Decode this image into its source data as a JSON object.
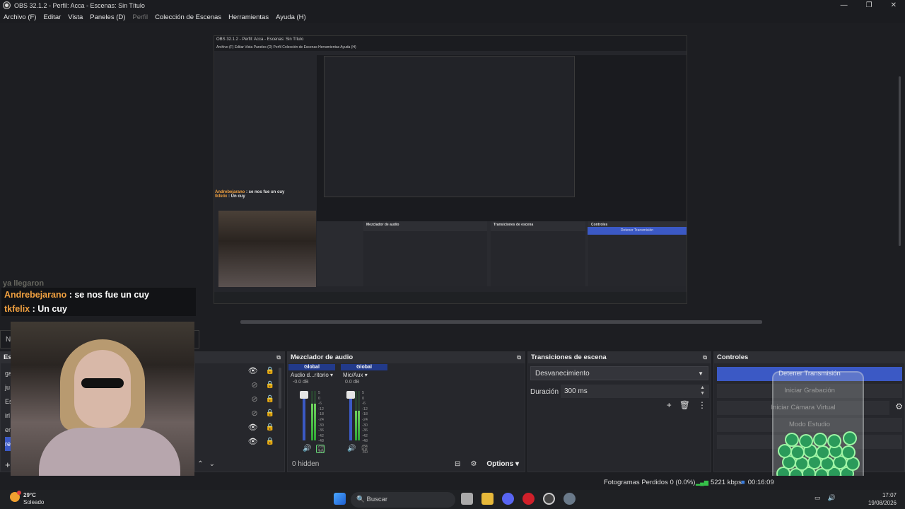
{
  "window": {
    "title": "OBS 32.1.2 - Perfil: Acca - Escenas: Sin Título",
    "btn_min": "—",
    "btn_max": "❐",
    "btn_close": "✕"
  },
  "menu": {
    "archivo": "Archivo (F)",
    "editar": "Editar",
    "vista": "Vista",
    "paneles": "Paneles (D)",
    "perfil": "Perfil",
    "coleccion": "Colección de Escenas",
    "herramientas": "Herramientas",
    "ayuda": "Ayuda (H)"
  },
  "nested": {
    "title": "OBS 32.1.2 - Perfil: Acca - Escenas: Sin Título",
    "menu": "Archivo (F)   Editar   Vista   Paneles (D)   Perfil   Colección de Escenas   Herramientas   Ayuda (H)",
    "chat_user1": "Andrebejarano",
    "chat_msg1": " : se nos fue un cuy",
    "chat_user2": "tkfelix",
    "chat_msg2": " : Un cuy",
    "mixer_title": "Mezclador de audio",
    "transitions_title": "Transiciones de escena",
    "controls_title": "Controles",
    "stop_label": "Detener Transmisión"
  },
  "scenes_strip": {
    "label": "Ni"
  },
  "docks": {
    "scenes_title": "Es",
    "scene_items": [
      "ga",
      "ju",
      "Es",
      "irl",
      "en",
      "re"
    ],
    "mixer_title": "Mezclador de audio",
    "transitions_title": "Transiciones de escena",
    "controls_title": "Controles"
  },
  "mixer": {
    "channels": [
      {
        "global": "Global",
        "name": "Audio d...ritorio",
        "db": "-0.0 dB",
        "level": 0.75
      },
      {
        "global": "Global",
        "name": "Mic/Aux",
        "db": "0.0 dB",
        "level": 0.6
      }
    ],
    "ticks": "5\n0\n-6\n-12\n-18\n-24\n-30\n-36\n-42\n-48\n-54\n-60",
    "hidden": "0 hidden",
    "options": "Options"
  },
  "transitions": {
    "selected": "Desvanecimiento",
    "duration_label": "Duración",
    "duration_value": "300 ms"
  },
  "controls": {
    "stop_stream": "Detener Transmisión",
    "record": "Iniciar Grabación",
    "virtual_cam": "Iniciar Cámara Virtual",
    "studio_mode": "Modo Estudio"
  },
  "chat": {
    "ghost_line": "ya llegaron",
    "user1": "Andrebejarano",
    "msg1": " : se nos fue un cuy",
    "user2": "tkfelix",
    "msg2": " : Un cuy"
  },
  "status": {
    "frames": "Fotogramas Perdidos 0 (0.0%)",
    "kbps": "5221 kbps",
    "time": "00:16:09"
  },
  "taskbar": {
    "temp": "29°C",
    "weather": "Soleado",
    "search": "Buscar",
    "time": "17:07",
    "date": "19/08/2026"
  },
  "colors": {
    "accent": "#3b59c5",
    "meter_green": "#2ea835",
    "chat_username": "#f0a040"
  }
}
